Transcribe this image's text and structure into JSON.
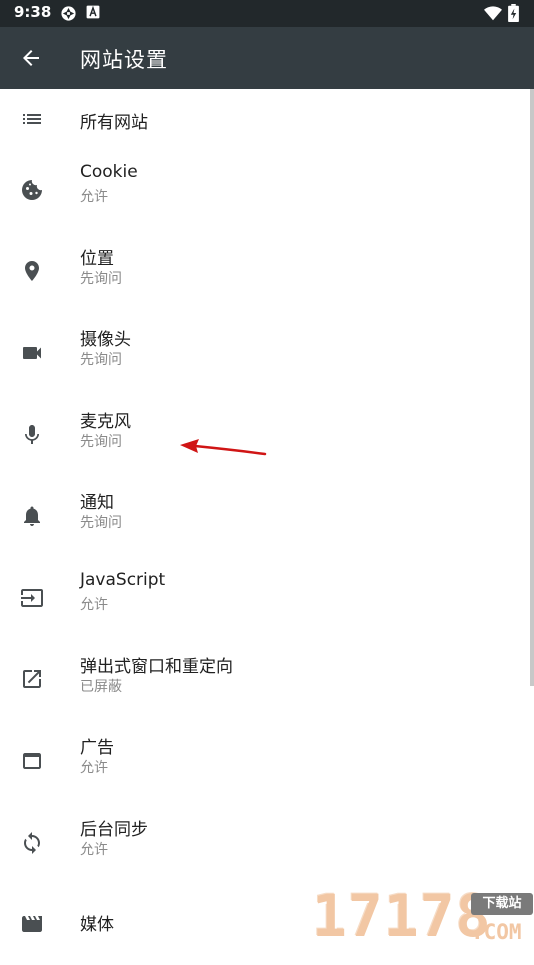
{
  "status_bar": {
    "time": "9:38"
  },
  "app_bar": {
    "title": "网站设置"
  },
  "items": [
    {
      "label": "所有网站",
      "icon": "list-icon"
    },
    {
      "label": "Cookie",
      "sub": "允许",
      "icon": "cookie-icon"
    },
    {
      "label": "位置",
      "sub": "先询问",
      "icon": "location-pin-icon"
    },
    {
      "label": "摄像头",
      "sub": "先询问",
      "icon": "video-camera-icon"
    },
    {
      "label": "麦克风",
      "sub": "先询问",
      "icon": "microphone-icon"
    },
    {
      "label": "通知",
      "sub": "先询问",
      "icon": "bell-icon"
    },
    {
      "label": "JavaScript",
      "sub": "允许",
      "icon": "javascript-input-icon"
    },
    {
      "label": "弹出式窗口和重定向",
      "sub": "已屏蔽",
      "icon": "external-link-icon"
    },
    {
      "label": "广告",
      "sub": "允许",
      "icon": "window-icon"
    },
    {
      "label": "后台同步",
      "sub": "允许",
      "icon": "sync-icon"
    },
    {
      "label": "媒体",
      "icon": "movie-clapper-icon"
    }
  ],
  "watermark": {
    "digits": "17178",
    "badge": "下载站",
    "domain": ".COM"
  },
  "colors": {
    "status_bar": "#22282b",
    "app_bar": "#343d42",
    "icon": "#4a4f52",
    "secondary_text": "#8a8a8a",
    "annotation_arrow": "#d01515"
  }
}
